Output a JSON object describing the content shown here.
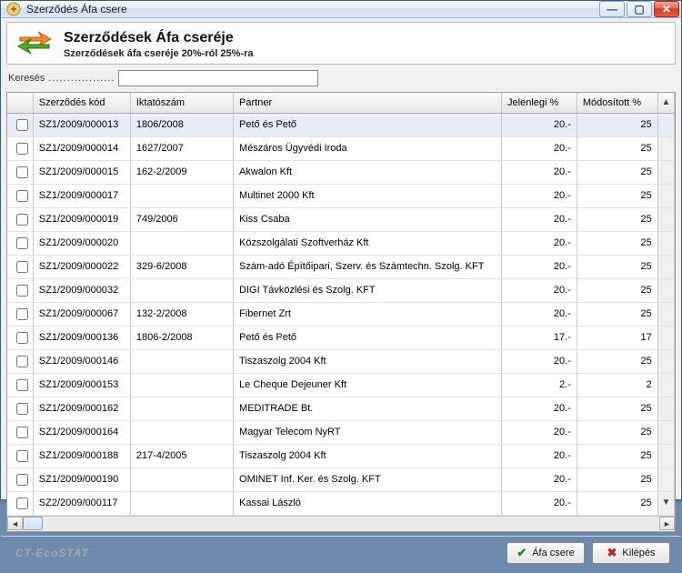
{
  "window": {
    "title": "Szerződés Áfa csere",
    "min": "—",
    "max": "▢",
    "close": "✕"
  },
  "header": {
    "title": "Szerződések Áfa cseréje",
    "subtitle": "Szerződések áfa cseréje 20%-ról 25%-ra"
  },
  "search": {
    "label": "Keresés",
    "dots": "..................",
    "value": ""
  },
  "columns": {
    "check": "",
    "code": "Szerződés kód",
    "ikt": "Iktatószám",
    "partner": "Partner",
    "current": "Jelenlegi %",
    "modified": "Módosított %"
  },
  "rows": [
    {
      "code": "SZ1/2009/000013",
      "ikt": "1806/2008",
      "partner": "Pető és Pető",
      "cur": "20.-",
      "mod": "25"
    },
    {
      "code": "SZ1/2009/000014",
      "ikt": "1627/2007",
      "partner": "Mészáros Ügyvédi Iroda",
      "cur": "20.-",
      "mod": "25"
    },
    {
      "code": "SZ1/2009/000015",
      "ikt": "162-2/2009",
      "partner": "Akwalon Kft",
      "cur": "20.-",
      "mod": "25"
    },
    {
      "code": "SZ1/2009/000017",
      "ikt": "",
      "partner": "Multinet 2000 Kft",
      "cur": "20.-",
      "mod": "25"
    },
    {
      "code": "SZ1/2009/000019",
      "ikt": "749/2006",
      "partner": "Kiss Csaba",
      "cur": "20.-",
      "mod": "25"
    },
    {
      "code": "SZ1/2009/000020",
      "ikt": "",
      "partner": "Közszolgálati Szoftverház Kft",
      "cur": "20.-",
      "mod": "25"
    },
    {
      "code": "SZ1/2009/000022",
      "ikt": "329-6/2008",
      "partner": "Szám-adó Építőipari, Szerv. és Számtechn. Szolg. KFT",
      "cur": "20.-",
      "mod": "25"
    },
    {
      "code": "SZ1/2009/000032",
      "ikt": "",
      "partner": "DIGI Távközlési és Szolg. KFT",
      "cur": "20.-",
      "mod": "25"
    },
    {
      "code": "SZ1/2009/000067",
      "ikt": "132-2/2008",
      "partner": "Fibernet Zrt",
      "cur": "20.-",
      "mod": "25"
    },
    {
      "code": "SZ1/2009/000136",
      "ikt": "1806-2/2008",
      "partner": "Pető és Pető",
      "cur": "17.-",
      "mod": "17"
    },
    {
      "code": "SZ1/2009/000146",
      "ikt": "",
      "partner": "Tiszaszolg 2004 Kft",
      "cur": "20.-",
      "mod": "25"
    },
    {
      "code": "SZ1/2009/000153",
      "ikt": "",
      "partner": "Le Cheque Dejeuner Kft",
      "cur": "2.-",
      "mod": "2"
    },
    {
      "code": "SZ1/2009/000162",
      "ikt": "",
      "partner": "MEDITRADE Bt.",
      "cur": "20.-",
      "mod": "25"
    },
    {
      "code": "SZ1/2009/000164",
      "ikt": "",
      "partner": "Magyar Telecom NyRT",
      "cur": "20.-",
      "mod": "25"
    },
    {
      "code": "SZ1/2009/000188",
      "ikt": "217-4/2005",
      "partner": "Tiszaszolg 2004 Kft",
      "cur": "20.-",
      "mod": "25"
    },
    {
      "code": "SZ1/2009/000190",
      "ikt": "",
      "partner": "OMINET Inf. Ker. és Szolg. KFT",
      "cur": "20.-",
      "mod": "25"
    },
    {
      "code": "SZ2/2009/000117",
      "ikt": "",
      "partner": "Kassai László",
      "cur": "20.-",
      "mod": "25"
    }
  ],
  "selected_index": 0,
  "brand": "CT-EcoSTAT",
  "buttons": {
    "apply": "Áfa csere",
    "exit": "Kilépés"
  },
  "scroll": {
    "up": "▲",
    "down": "▼",
    "left": "◄",
    "right": "►"
  }
}
